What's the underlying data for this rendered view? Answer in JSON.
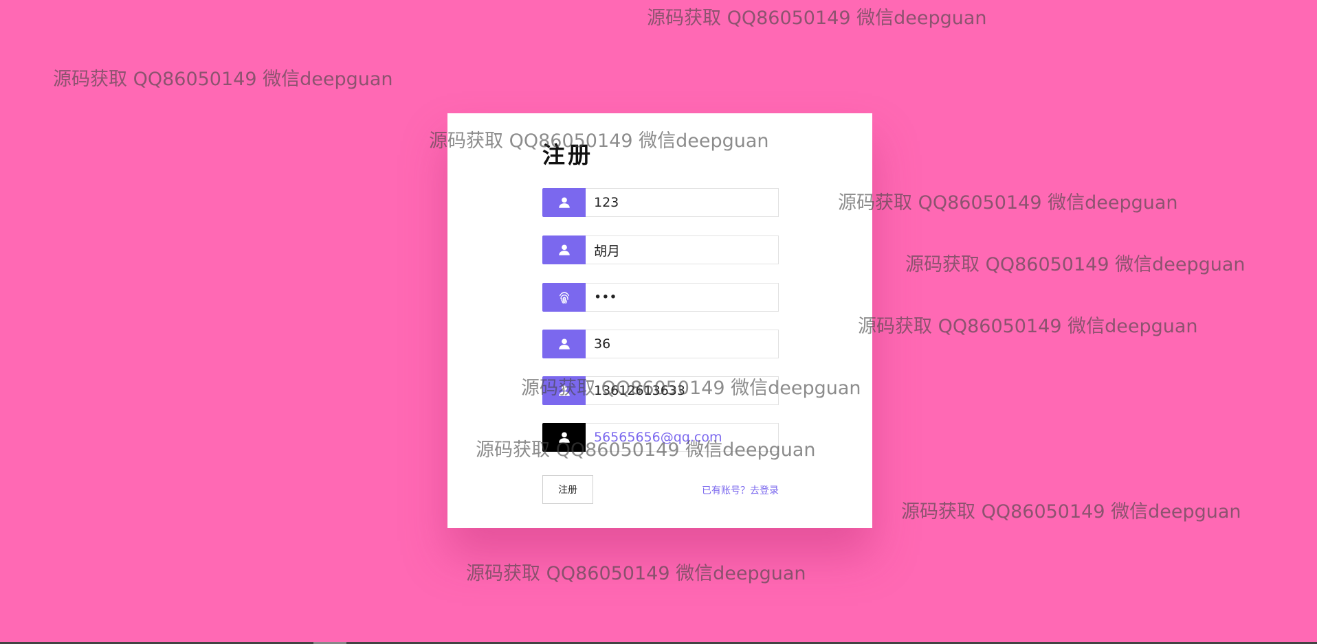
{
  "form": {
    "title": "注册",
    "fields": [
      {
        "icon": "user-icon",
        "value": "123"
      },
      {
        "icon": "user-icon",
        "value": "胡月"
      },
      {
        "icon": "fingerprint-icon",
        "value": "•••"
      },
      {
        "icon": "user-icon",
        "value": "36"
      },
      {
        "icon": "user-icon",
        "value": "13612613633"
      },
      {
        "icon": "user-icon",
        "value": "56565656@qq.com"
      }
    ],
    "submit_label": "注册",
    "login_link": "已有账号？去登录"
  },
  "watermark_text": "源码获取 QQ86050149 微信deepguan",
  "colors": {
    "background": "#ff69b4",
    "accent": "#7b68ee",
    "focused_icon": "#000000"
  }
}
